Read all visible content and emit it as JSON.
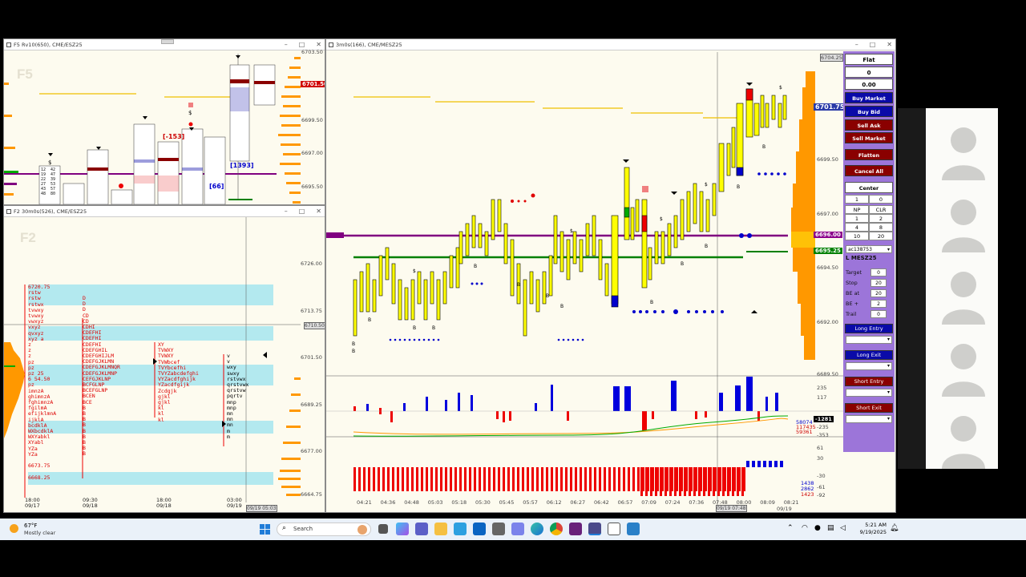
{
  "windows": {
    "f5": {
      "title": "F5 Rv10(650), CME/ESZ25",
      "label": "F5",
      "price_ticks": [
        "6703.50",
        "6699.50",
        "6697.00",
        "6695.50"
      ],
      "price_tag": "6701.50"
    },
    "f2": {
      "title": "F2 30m0s(526), CME/ESZ25",
      "label": "F2",
      "price_ticks": [
        "6726.00",
        "6713.75",
        "6701.50",
        "6689.25",
        "6677.00",
        "6664.75"
      ],
      "price_tag": "6710.50",
      "time_labels": [
        {
          "t": "18:00",
          "d": "09/17"
        },
        {
          "t": "09:30",
          "d": "09/18"
        },
        {
          "t": "18:00",
          "d": "09/18"
        },
        {
          "t": "03:00",
          "d": "09/19"
        }
      ],
      "cursor_time": "09/19 05:03",
      "value_areas": [
        "6720.75",
        "6673.75",
        "6668.25"
      ],
      "tpo_cols": [
        "6720.75\nrstw\nrstw\nrstwx\ntvwxy\ntvwxy\nvwxyz\nvxyz\nqvxyz\nxyz a\nz\nz\nz\npz\npz\npz 25\n6 54.50\npz\nimnzA\nghimnzA\nfghimnzA\nfgilmA\nefijklmnA\nijklA\nbcdklA\nWXbcdklA\nWXYabkl\nXYabl\nYZa\nYZa\n\n6673.75\n\n6668.25",
        "D\nD\nD\nCD\nCD\nCDHI\nCDEFHI\nCDEFHI\nCDEFHI\nCDEFGHIL\nCDEFGHIJLM\nCDEFGJKLMN\nCDEFGJKLMNQR\nCDEFGJKLMNP\nCEFGJKLNP\nBCFGLNP\nBCEFGLNP\nBCEN\nBCE\nB\nB\nB\nB\nB\nB\nB\nB\nB",
        "XY\nTVWXY\nTVWXY\nTVWbcef\nTVYbcefhi\nTVYZabcdefghi\nVYZacdfghijk\nYZacdfgijk\nZcdgjk\ngjkl\ngjkl\nkl\nkl\nkl",
        "v\nv\nwxy\nswxy\nrstvwx\nqrstvwx\nqrstvw\npqrtv\nmnp\nmnp\nmn\nmn\nmn\nm\nm"
      ]
    },
    "main": {
      "title": "3m0s(166), CME/MESZ25",
      "price_ticks": [
        "6699.50",
        "6697.00",
        "6694.50",
        "6692.00",
        "6689.50"
      ],
      "top_tag": "6704.25",
      "price_tag": "6701.75",
      "purple_tag": "6696.00",
      "green_tag": "6695.25",
      "delta_ticks": [
        "235",
        "117",
        "-235",
        "-353"
      ],
      "delta_tag": "-1281",
      "cvd_vals": [
        "58074",
        "117435",
        "59361"
      ],
      "lower_ticks": [
        "61",
        "30",
        "-30",
        "-61",
        "-92"
      ],
      "lower_vals": [
        "1438",
        "2862",
        "1423"
      ],
      "time_labels": [
        "04:21",
        "04:36",
        "04:48",
        "05:03",
        "05:18",
        "05:30",
        "05:45",
        "05:57",
        "06:12",
        "06:27",
        "06:42",
        "06:57",
        "07:09",
        "07:24",
        "07:36",
        "07:48",
        "08:00",
        "08:09",
        "08:21"
      ],
      "cursor_time": "09/19 07:48",
      "last_date": "09/19"
    }
  },
  "order_panel": {
    "position": "Flat",
    "qty": "0",
    "pnl": "0.00",
    "buy_market": "Buy Market",
    "buy_bid": "Buy Bid",
    "sell_ask": "Sell Ask",
    "sell_market": "Sell Market",
    "flatten": "Flatten",
    "cancel_all": "Cancel All",
    "center": "Center",
    "qty_a": "1",
    "qty_b": "0",
    "np": "NP",
    "clr": "CLR",
    "grid": [
      "1",
      "2",
      "4",
      "8",
      "10",
      "20"
    ],
    "account": "ac138753",
    "symbol_label": "L MESZ25",
    "target_label": "Target",
    "target_val": "0",
    "stop_label": "Stop",
    "stop_val": "20",
    "beat_label": "BE at",
    "beat_val": "20",
    "beplus_label": "BE +",
    "beplus_val": "2",
    "trail_label": "Trail",
    "trail_val": "0",
    "long_entry": "Long Entry",
    "long_exit": "Long Exit",
    "short_entry": "Short Entry",
    "short_exit": "Short Exit"
  },
  "taskbar": {
    "temp": "67°F",
    "weather": "Mostly clear",
    "search": "Search",
    "time": "5:21 AM",
    "date": "9/19/2025"
  },
  "colors": {
    "buy": "#0a0aa8",
    "sell": "#8a0000",
    "panel": "#9c75d9",
    "ohlc_up": "#ffff00",
    "poc": "#800080",
    "vwap": "#008000",
    "profile": "#ff9800"
  }
}
